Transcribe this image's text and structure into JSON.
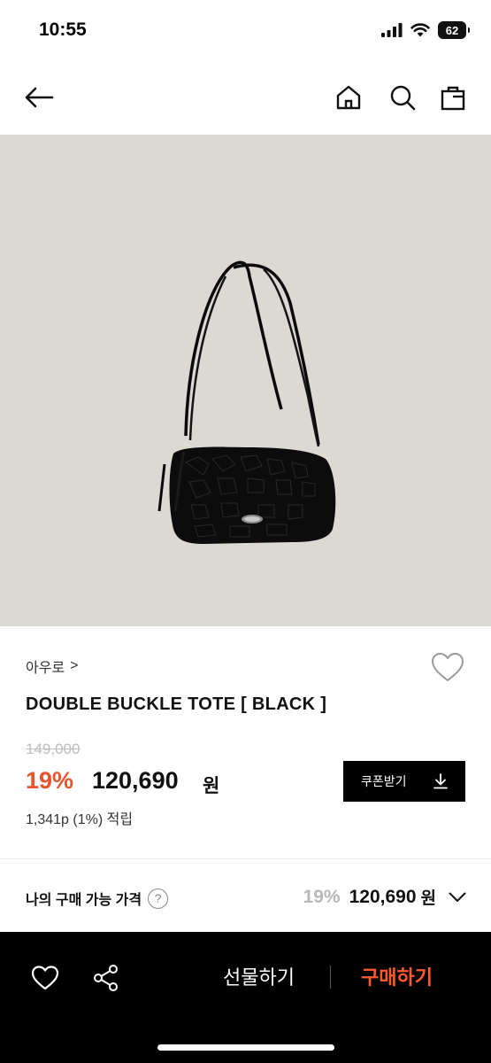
{
  "status_bar": {
    "time": "10:55",
    "battery": "62",
    "icons": [
      "signal-icon",
      "wifi-icon",
      "battery-icon"
    ]
  },
  "nav": {
    "icons": [
      "back-arrow-icon",
      "home-icon",
      "search-icon",
      "shopping-bag-icon"
    ]
  },
  "product": {
    "image_desc_icon": "black-croc-shoulder-bag",
    "brand": "아우로",
    "brand_chevron": ">",
    "name": "DOUBLE BUCKLE TOTE [ BLACK ]",
    "original_price": "149,000",
    "discount": "19%",
    "sale_price": "120,690",
    "currency": "원",
    "points": "1,341p (1%) 적립"
  },
  "coupon": {
    "label": "쿠폰받기"
  },
  "my_price": {
    "label": "나의 구매 가능 가격",
    "help": "?",
    "discount": "19%",
    "amount": "120,690",
    "currency": "원"
  },
  "bottom_bar": {
    "gift_label": "선물하기",
    "buy_label": "구매하기"
  },
  "colors": {
    "accent": "#e8542b",
    "buy": "#ff5a2a",
    "image_bg": "#dcd9d4",
    "bar_bg": "#000000"
  }
}
